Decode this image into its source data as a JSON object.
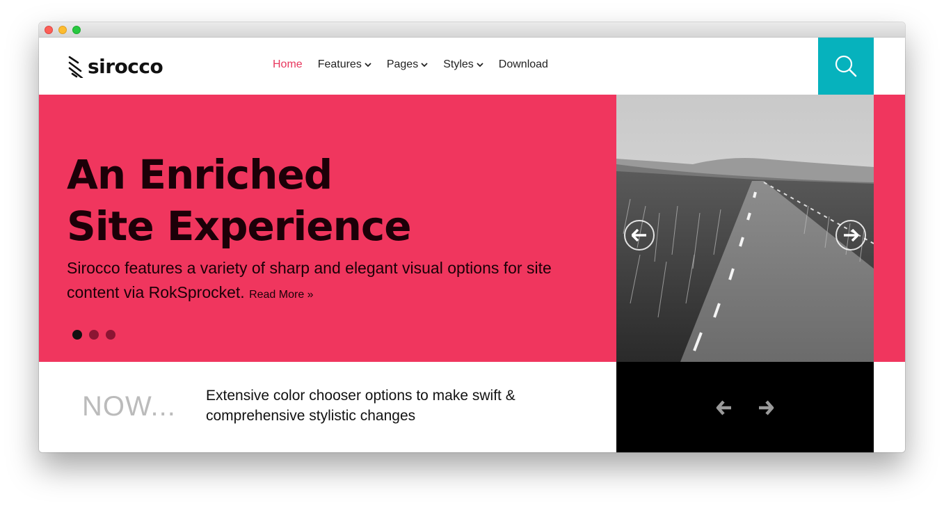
{
  "logo": {
    "text": "sirocco"
  },
  "nav": {
    "items": [
      {
        "label": "Home",
        "active": true,
        "dropdown": false
      },
      {
        "label": "Features",
        "active": false,
        "dropdown": true
      },
      {
        "label": "Pages",
        "active": false,
        "dropdown": true
      },
      {
        "label": "Styles",
        "active": false,
        "dropdown": true
      },
      {
        "label": "Download",
        "active": false,
        "dropdown": false
      }
    ],
    "search_icon": "search-icon"
  },
  "hero": {
    "title_line1": "An Enriched",
    "title_line2": "Site Experience",
    "description": "Sirocco features a variety of sharp and elegant visual options for site content via RokSprocket.",
    "read_more": "Read More »",
    "slide_count": 3,
    "active_slide": 1
  },
  "bottom": {
    "now_label": "NOW...",
    "now_text": "Extensive color chooser options to make swift & comprehensive stylistic changes"
  },
  "colors": {
    "accent": "#f0365e",
    "nav_active": "#e8365d",
    "search_bg": "#06b2bd",
    "title_text": "#1c0008"
  }
}
